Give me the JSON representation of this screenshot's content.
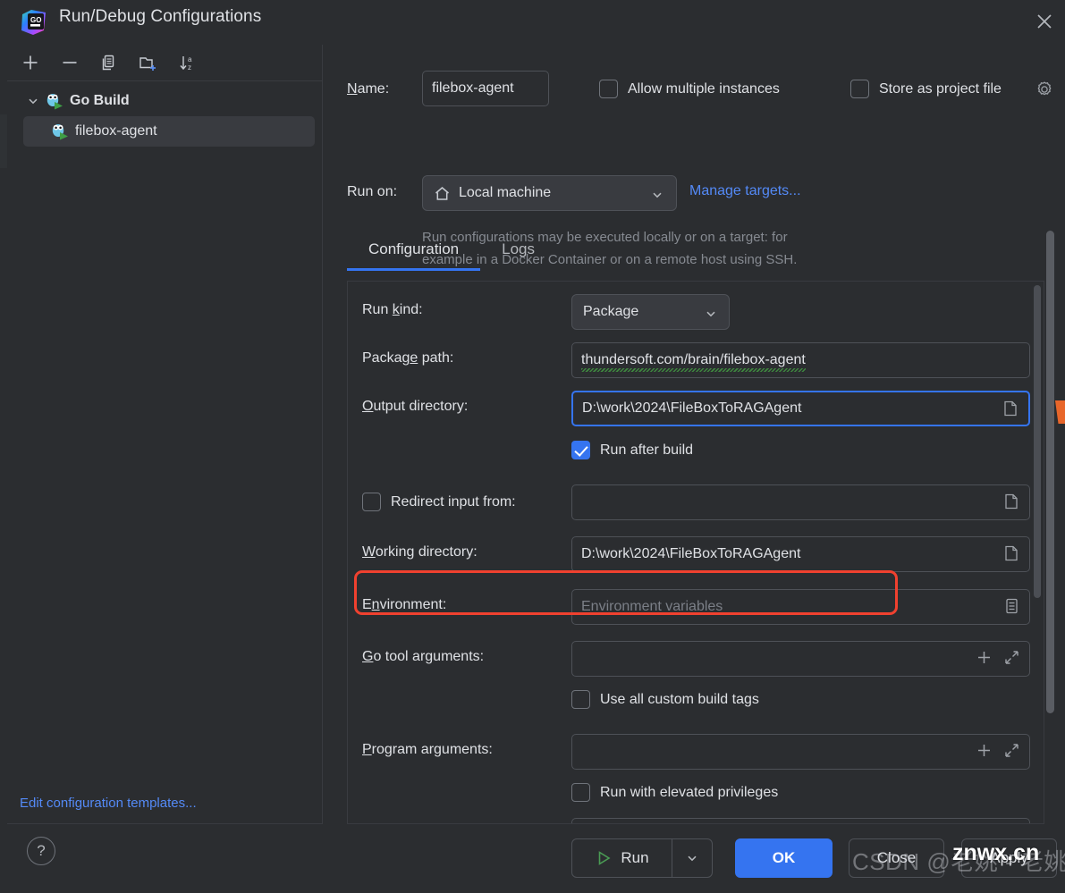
{
  "window": {
    "title": "Run/Debug Configurations",
    "logo_icon": "goland-logo-icon",
    "close_icon": "close-icon"
  },
  "sidebar": {
    "toolbar": [
      {
        "name": "add-configuration-button",
        "icon": "plus-icon"
      },
      {
        "name": "remove-configuration-button",
        "icon": "minus-icon"
      },
      {
        "name": "copy-configuration-button",
        "icon": "copy-icon"
      },
      {
        "name": "new-folder-button",
        "icon": "new-folder-icon"
      },
      {
        "name": "sort-configurations-button",
        "icon": "sort-alpha-icon"
      }
    ],
    "tree": {
      "group_label": "Go Build",
      "group_icon": "go-gopher-run-icon",
      "child_label": "filebox-agent",
      "child_icon": "go-gopher-run-icon"
    },
    "edit_templates_link": "Edit configuration templates..."
  },
  "header": {
    "name_label": "Name:",
    "name_value": "filebox-agent",
    "allow_multiple_instances_label": "Allow multiple instances",
    "allow_multiple_instances_checked": false,
    "store_as_project_file_label": "Store as project file",
    "store_as_project_file_checked": false,
    "store_gear_icon": "gear-icon",
    "run_on_label": "Run on:",
    "run_on_value": "Local machine",
    "run_on_icon": "home-icon",
    "manage_targets_link": "Manage targets...",
    "hint_line1": "Run configurations may be executed locally or on a target: for",
    "hint_line2": "example in a Docker Container or on a remote host using SSH."
  },
  "tabs": [
    {
      "label": "Configuration",
      "active": true
    },
    {
      "label": "Logs",
      "active": false
    }
  ],
  "form": {
    "run_kind_label": "Run kind:",
    "run_kind_value": "Package",
    "package_path_label": "Package path:",
    "package_path_value": "thundersoft.com/brain/filebox-agent",
    "output_directory_label": "Output directory:",
    "output_directory_value": "D:\\work\\2024\\FileBoxToRAGAgent",
    "output_browse_icon": "folder-browse-icon",
    "run_after_build_label": "Run after build",
    "run_after_build_checked": true,
    "redirect_input_label": "Redirect input from:",
    "redirect_input_checked": false,
    "redirect_input_value": "",
    "redirect_browse_icon": "folder-browse-icon",
    "working_directory_label": "Working directory:",
    "working_directory_value": "D:\\work\\2024\\FileBoxToRAGAgent",
    "working_browse_icon": "folder-browse-icon",
    "environment_label": "Environment:",
    "environment_placeholder": "Environment variables",
    "environment_icon": "environment-list-icon",
    "go_tool_arguments_label": "Go tool arguments:",
    "go_tool_arguments_value": "",
    "go_tool_add_icon": "plus-icon",
    "go_tool_expand_icon": "expand-icon",
    "use_all_custom_build_tags_label": "Use all custom build tags",
    "use_all_custom_build_tags_checked": false,
    "program_arguments_label": "Program arguments:",
    "program_arguments_value": "",
    "program_add_icon": "plus-icon",
    "program_expand_icon": "expand-icon",
    "run_with_elevated_privileges_label": "Run with elevated privileges",
    "run_with_elevated_privileges_checked": false
  },
  "footer": {
    "help_label": "?",
    "run_label": "Run",
    "run_icon": "play-triangle-icon",
    "run_dropdown_icon": "chevron-down-icon",
    "ok_label": "OK",
    "close_label": "Close",
    "apply_label": "Apply"
  },
  "watermark": {
    "text": "CSDN @老姚 - 老姚",
    "badge": "znwx.cn"
  },
  "colors": {
    "accent": "#3574f0",
    "link": "#548af7",
    "highlight_red": "#f0412f",
    "background": "#2b2d30",
    "marker_orange": "#e8662a"
  }
}
